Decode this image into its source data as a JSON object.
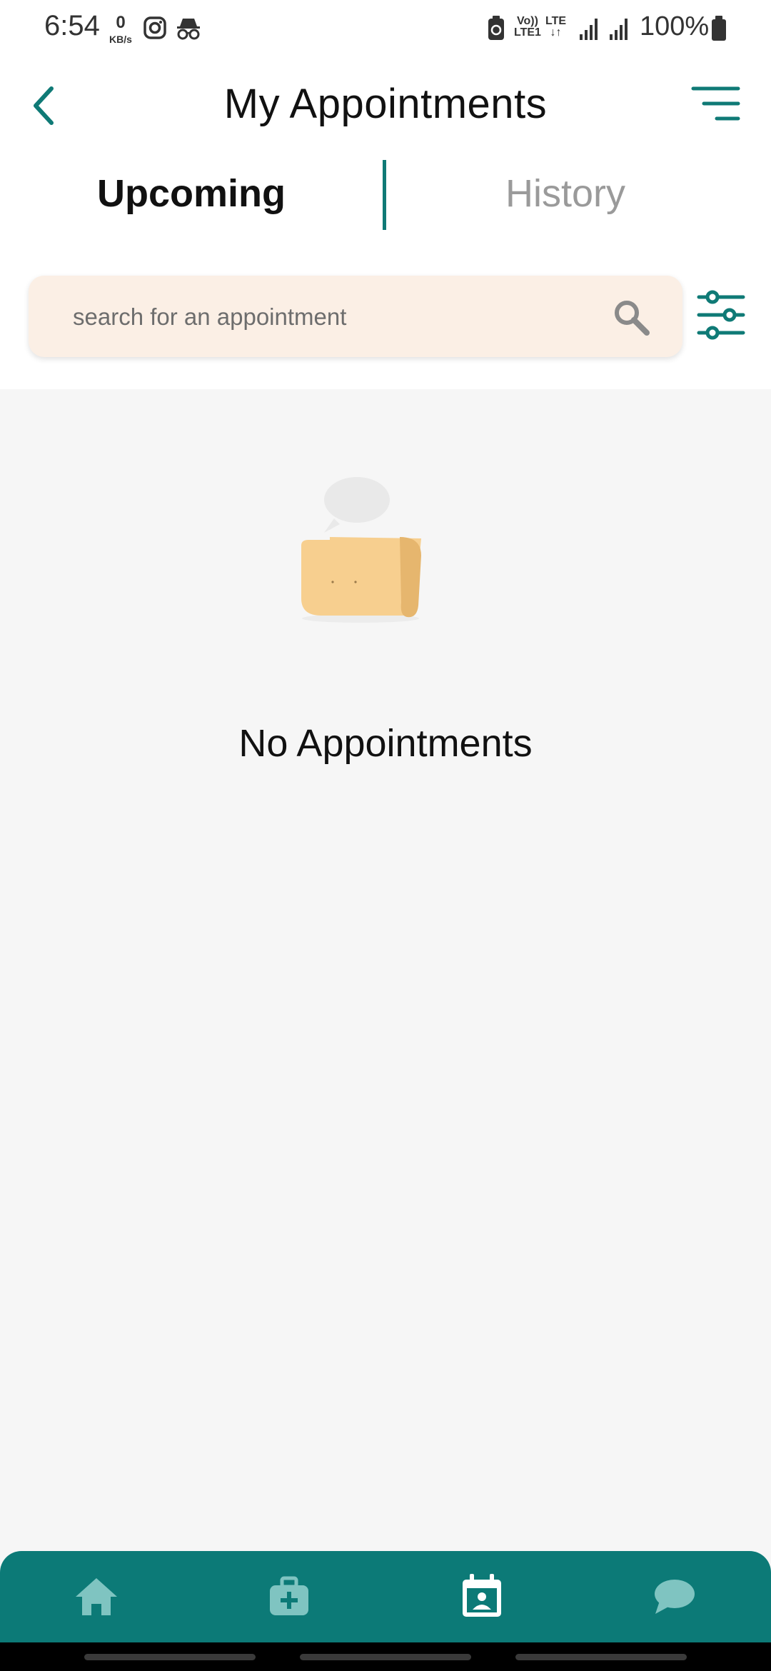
{
  "status_bar": {
    "time": "6:54",
    "net_speed_value": "0",
    "net_speed_unit": "KB/s",
    "volte_line1": "Vo))",
    "volte_line2": "LTE1",
    "lte_line1": "LTE",
    "lte_line2": "↓↑",
    "battery_percent": "100%",
    "icons": [
      "instagram-icon",
      "incognito-icon",
      "battery-saver-icon",
      "signal-icon",
      "signal-icon",
      "battery-icon"
    ]
  },
  "header": {
    "title": "My Appointments",
    "back_icon": "chevron-left-icon",
    "menu_icon": "menu-icon"
  },
  "tabs": [
    {
      "label": "Upcoming",
      "active": true
    },
    {
      "label": "History",
      "active": false
    }
  ],
  "search": {
    "value": "",
    "placeholder": "search for an appointment",
    "icon": "search-icon",
    "filter_icon": "sliders-icon"
  },
  "empty_state": {
    "message": "No Appointments",
    "illustration": "empty-scroll-illustration"
  },
  "bottom_nav": {
    "items": [
      {
        "icon": "home-icon",
        "active": false
      },
      {
        "icon": "medical-kit-icon",
        "active": false
      },
      {
        "icon": "calendar-user-icon",
        "active": true
      },
      {
        "icon": "chat-icon",
        "active": false
      }
    ]
  },
  "colors": {
    "accent": "#0c7a77",
    "search_bg": "#fbefe5",
    "background": "#f6f6f6",
    "inactive_icon": "#7fc4c1"
  }
}
